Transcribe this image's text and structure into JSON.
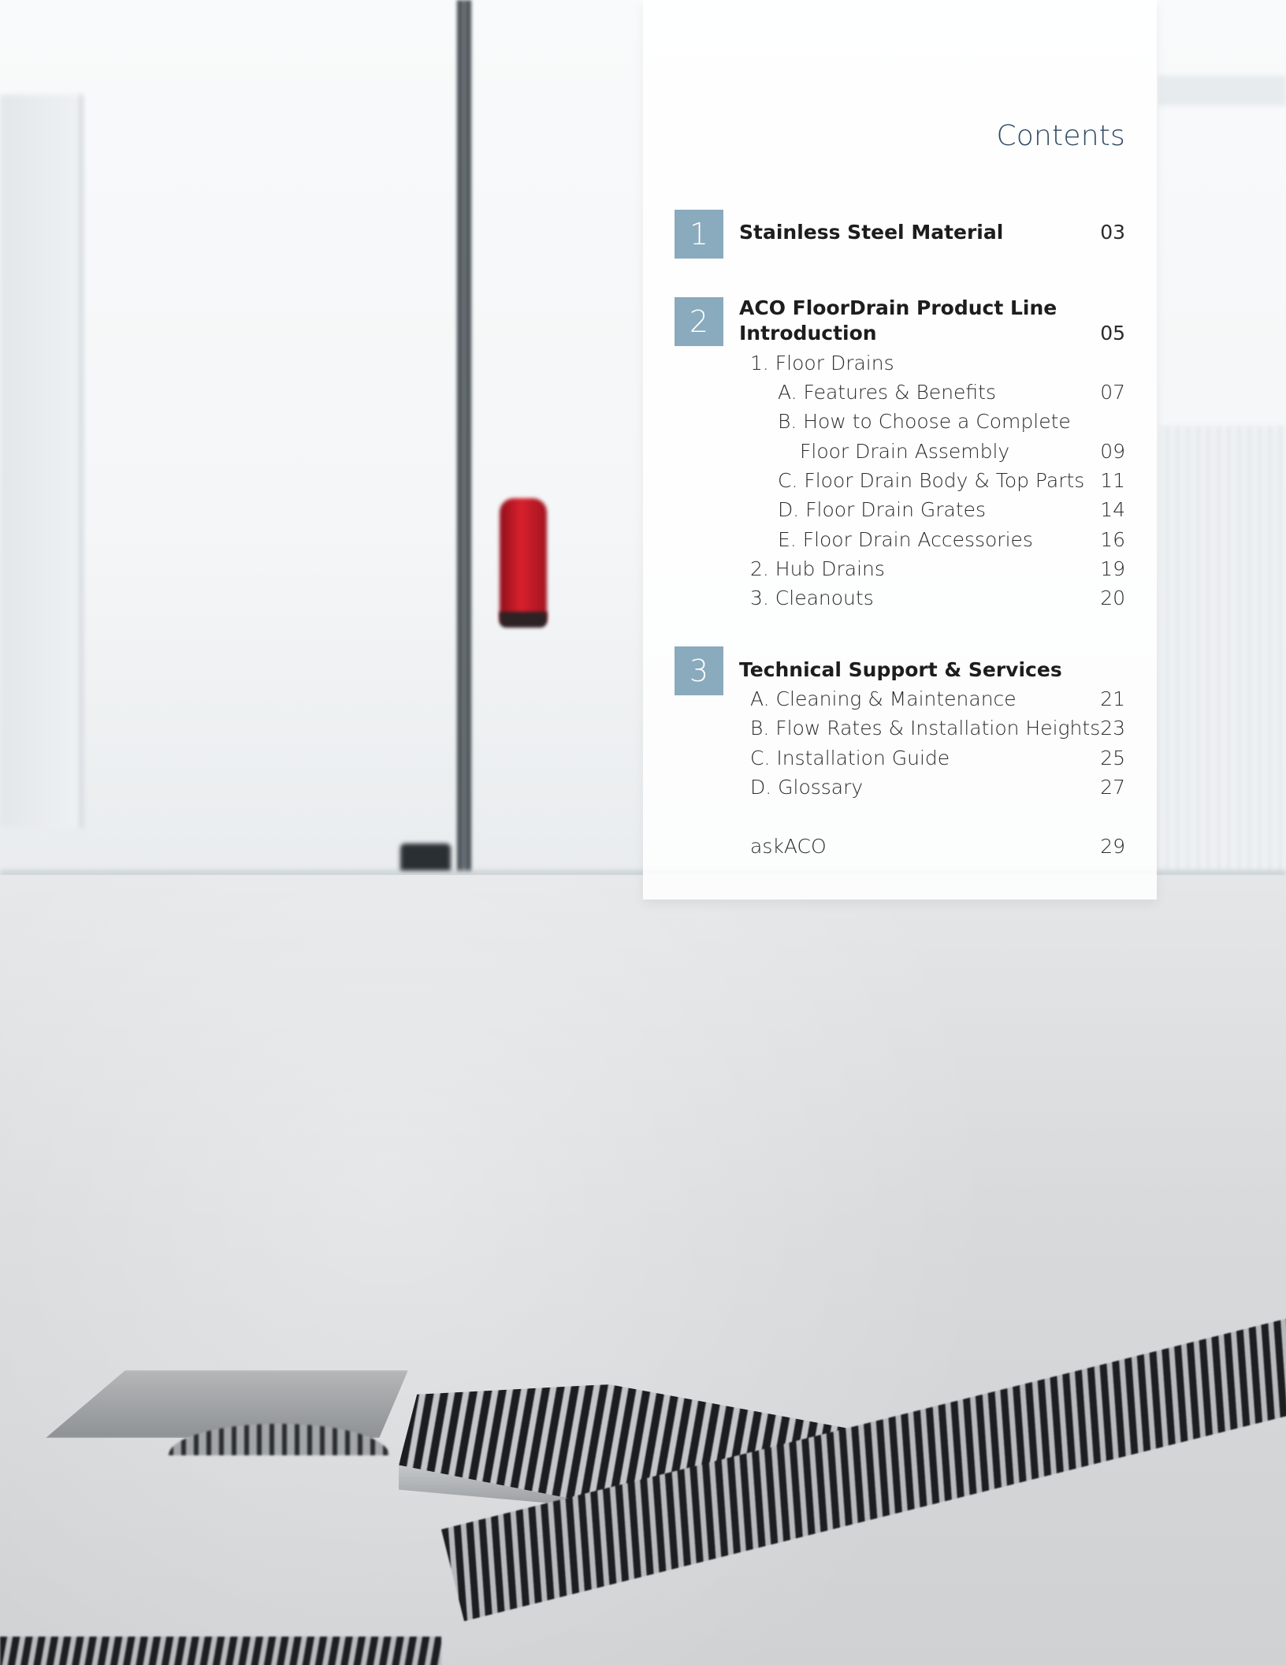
{
  "title": "Contents",
  "sections": [
    {
      "number": "1",
      "entries": [
        {
          "label": "Stainless Steel Material",
          "page": "03"
        }
      ]
    },
    {
      "number": "2",
      "heading_line1": "ACO FloorDrain Product Line",
      "entries": [
        {
          "label": "Introduction",
          "page": "05"
        },
        {
          "label": "1. Floor Drains",
          "page": ""
        },
        {
          "label": "A. Features & Benefits",
          "page": "07"
        },
        {
          "label": "B. How to Choose a Complete",
          "page": ""
        },
        {
          "label": "Floor Drain Assembly",
          "page": "09"
        },
        {
          "label": "C. Floor Drain Body & Top Parts",
          "page": "11"
        },
        {
          "label": "D. Floor Drain Grates",
          "page": "14"
        },
        {
          "label": "E. Floor Drain Accessories",
          "page": "16"
        },
        {
          "label": "2. Hub Drains",
          "page": "19"
        },
        {
          "label": "3. Cleanouts",
          "page": "20"
        }
      ]
    },
    {
      "number": "3",
      "entries": [
        {
          "label": "Technical Support & Services",
          "page": ""
        },
        {
          "label": "A. Cleaning & Maintenance",
          "page": "21"
        },
        {
          "label": "B. Flow Rates & Installation Heights",
          "page": "23"
        },
        {
          "label": "C. Installation Guide",
          "page": "25"
        },
        {
          "label": "D. Glossary",
          "page": "27"
        }
      ]
    }
  ],
  "footer_entry": {
    "label": "askACO",
    "page": "29"
  },
  "colors": {
    "accent": "#8aaabd",
    "title": "#2f4b66"
  }
}
